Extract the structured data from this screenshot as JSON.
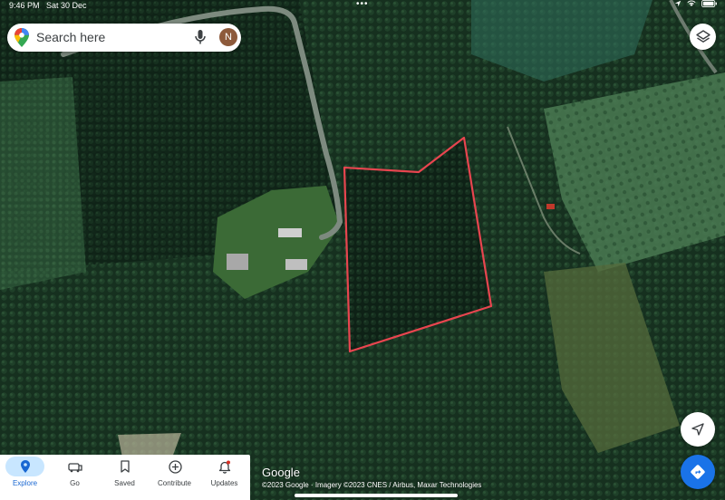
{
  "status_bar": {
    "time": "9:46 PM",
    "date": "Sat 30 Dec",
    "dots": "•••"
  },
  "search": {
    "placeholder": "Search here",
    "avatar_initial": "N"
  },
  "map": {
    "layer": "satellite",
    "boundary_color": "#e8454f",
    "google_logo": "Google",
    "attribution": "©2023 Google · Imagery ©2023 CNES / Airbus, Maxar Technologies"
  },
  "controls": {
    "layers_icon": "layers-icon",
    "locate_icon": "navigation-arrow-icon",
    "directions_icon": "directions-icon",
    "accent": "#1a73e8"
  },
  "bottom_nav": {
    "items": [
      {
        "label": "Explore",
        "icon": "explore-pin-icon",
        "active": true
      },
      {
        "label": "Go",
        "icon": "car-icon",
        "active": false
      },
      {
        "label": "Saved",
        "icon": "bookmark-icon",
        "active": false
      },
      {
        "label": "Contribute",
        "icon": "add-circle-icon",
        "active": false
      },
      {
        "label": "Updates",
        "icon": "bell-icon",
        "active": false
      }
    ]
  }
}
